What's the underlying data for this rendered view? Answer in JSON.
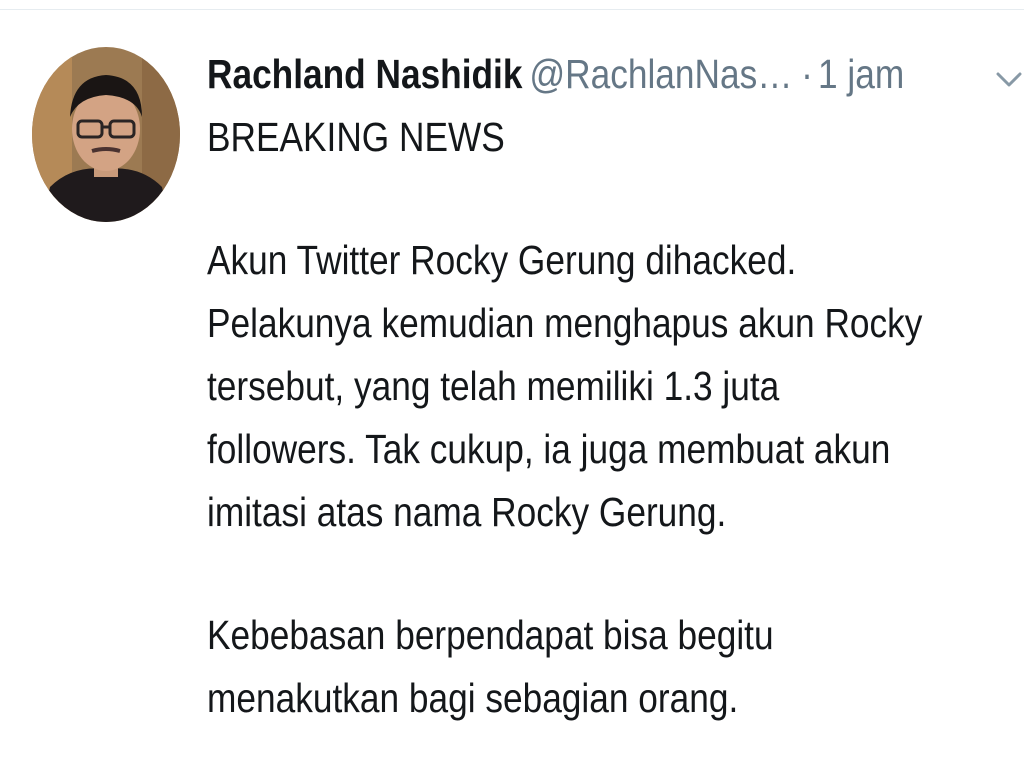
{
  "tweet": {
    "author_name": "Rachland Nashidik",
    "author_handle": "@RachlanNas…",
    "separator": "·",
    "timestamp": "1 jam",
    "avatar_icon": "profile-photo-avatar",
    "caret_icon": "chevron-down-icon",
    "headline": "BREAKING NEWS",
    "paragraph1_lines": [
      "Akun Twitter Rocky Gerung dihacked.",
      "Pelakunya kemudian menghapus akun Rocky",
      "tersebut, yang telah memiliki 1.3 juta",
      "followers. Tak cukup, ia juga membuat akun",
      "imitasi atas nama Rocky Gerung."
    ],
    "paragraph2_lines": [
      "Kebebasan berpendapat bisa begitu",
      "menakutkan bagi sebagian orang."
    ]
  },
  "colors": {
    "text_primary": "#14171a",
    "text_secondary": "#657786",
    "divider": "#e6ecf0",
    "background": "#ffffff"
  }
}
